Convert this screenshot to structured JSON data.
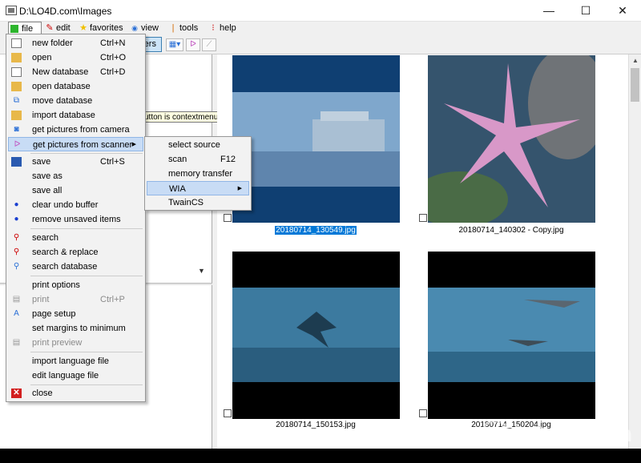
{
  "window": {
    "title": "D:\\LO4D.com\\Images",
    "minimize_glyph": "—",
    "maximize_glyph": "☐",
    "close_glyph": "✕"
  },
  "menubar": {
    "file": "file",
    "edit": "edit",
    "favorites": "favorites",
    "view": "view",
    "tools": "tools",
    "help": "help"
  },
  "toolbar": {
    "folders_label": "olders"
  },
  "tooltip": {
    "text": "utton is contextmenu!"
  },
  "file_menu": {
    "new_folder": {
      "label": "new folder",
      "shortcut": "Ctrl+N"
    },
    "open": {
      "label": "open",
      "shortcut": "Ctrl+O"
    },
    "new_database": {
      "label": "New database",
      "shortcut": "Ctrl+D"
    },
    "open_database": {
      "label": "open database"
    },
    "move_database": {
      "label": "move database"
    },
    "import_database": {
      "label": "import database"
    },
    "get_from_camera": {
      "label": "get pictures from camera"
    },
    "get_from_scanner": {
      "label": "get pictures from scanner"
    },
    "save": {
      "label": "save",
      "shortcut": "Ctrl+S"
    },
    "save_as": {
      "label": "save as"
    },
    "save_all": {
      "label": "save all"
    },
    "clear_undo": {
      "label": "clear undo buffer"
    },
    "remove_unsaved": {
      "label": "remove unsaved items"
    },
    "search": {
      "label": "search"
    },
    "search_replace": {
      "label": "search & replace"
    },
    "search_database": {
      "label": "search database"
    },
    "print_options": {
      "label": "print options"
    },
    "print": {
      "label": "print",
      "shortcut": "Ctrl+P"
    },
    "page_setup": {
      "label": "page setup"
    },
    "set_margins": {
      "label": "set margins to minimum"
    },
    "print_preview": {
      "label": "print preview"
    },
    "import_language": {
      "label": "import language file"
    },
    "edit_language": {
      "label": "edit language file"
    },
    "close": {
      "label": "close"
    }
  },
  "scanner_submenu": {
    "select_source": {
      "label": "select source"
    },
    "scan": {
      "label": "scan",
      "shortcut": "F12"
    },
    "memory_transfer": {
      "label": "memory transfer"
    },
    "wia": {
      "label": "WIA"
    },
    "twaincs": {
      "label": "TwainCS"
    }
  },
  "gallery": {
    "items": [
      {
        "filename": "20180714_130549.jpg",
        "selected": true
      },
      {
        "filename": "20180714_140302 - Copy.jpg",
        "selected": false
      },
      {
        "filename": "20180714_150153.jpg",
        "selected": false
      },
      {
        "filename": "20180714_150204.jpg",
        "selected": false
      }
    ]
  },
  "watermark": {
    "text": "LO4D.com"
  },
  "colors": {
    "selection": "#0078d7",
    "menu_highlight": "#c8dcf5",
    "folders_button": "#cce4f7"
  }
}
